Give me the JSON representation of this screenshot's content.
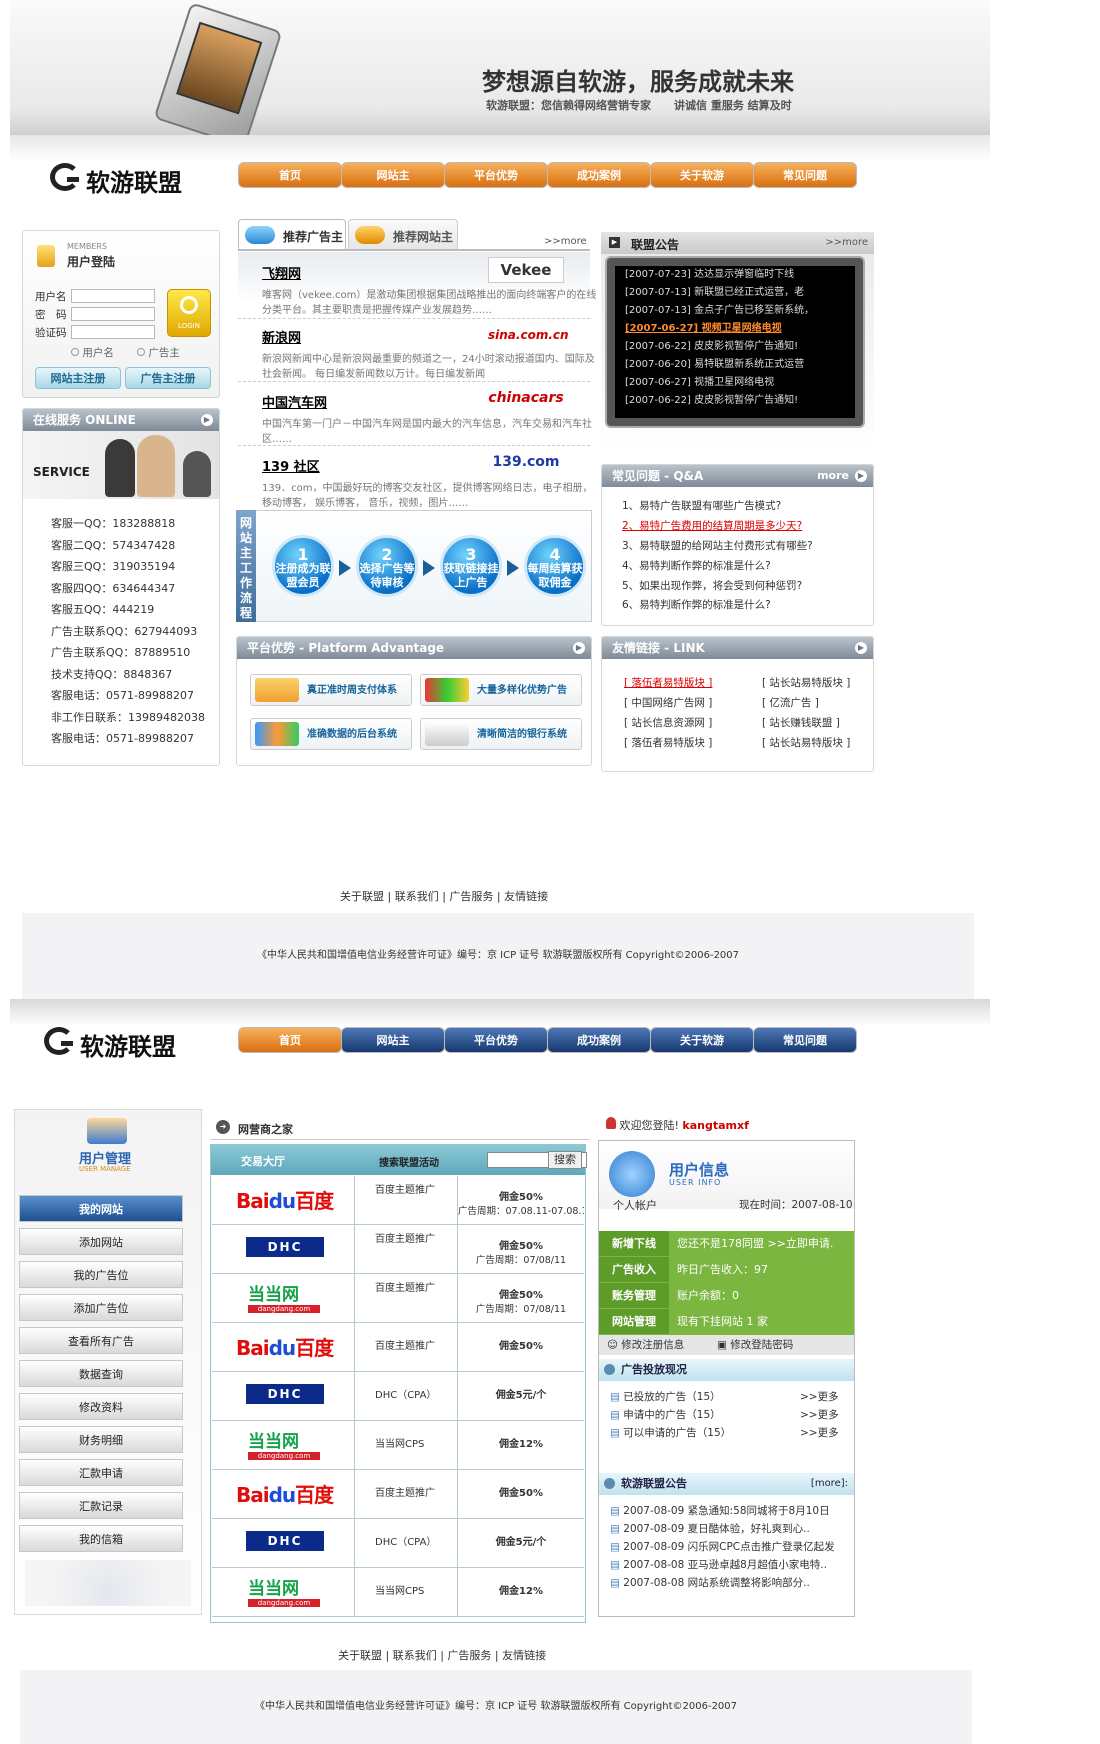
{
  "banner": {
    "slogan": "梦想源自软游，服务成就未来",
    "sub1": "软游联盟：您信赖得网络营销专家",
    "sub2": "讲诚信 重服务 结算及时"
  },
  "brand": {
    "name": "软游联盟"
  },
  "nav": [
    "首页",
    "网站主",
    "平台优势",
    "成功案例",
    "关于软游",
    "常见问题"
  ],
  "login": {
    "title": "用户登陆",
    "members": "MEMBERS",
    "user_label": "用户名",
    "pass_label": "密　码",
    "code_label": "验证码",
    "radio1": "用户名",
    "radio2": "广告主",
    "login_btn": "LOGIN",
    "reg_site": "网站主注册",
    "reg_adv": "广告主注册"
  },
  "online": {
    "title": "在线服务 ONLINE",
    "service": "SERVICE",
    "contacts": [
      "客服一QQ：183288818",
      "客服二QQ：574347428",
      "客服三QQ：319035194",
      "客服四QQ：634644347",
      "客服五QQ：444219",
      "广告主联系QQ：627944093",
      "广告主联系QQ：87889510",
      "技术支持QQ：8848367",
      "客服电话：0571-89988207",
      "非工作日联系：13989482038",
      "客服电话：0571-89988207"
    ]
  },
  "tabs": {
    "tab1": "推荐广告主",
    "tab2": "推荐网站主",
    "more": ">>more"
  },
  "ads_list": [
    {
      "name": "飞翔网",
      "logo": "Vekee",
      "desc": "唯客网（vekee.com）是激动集团根据集团战略推出的面向终端客户的在线分类平台。其主要职责是把握传媒产业发展趋势……"
    },
    {
      "name": "新浪网",
      "logo": "sina.com.cn",
      "desc": "新浪网新闻中心是新浪网最重要的频道之一，24小时滚动报道国内、国际及社会新闻。 每日编发新闻数以万计。每日编发新闻"
    },
    {
      "name": "中国汽车网",
      "logo": "chinacars",
      "desc": "中国汽车第一门户－中国汽车网是国内最大的汽车信息，汽车交易和汽车社区……"
    },
    {
      "name": "139 社区",
      "logo": "139.com",
      "desc": "139．com，中国最好玩的博客交友社区，提供博客网络日志，电子相册，移动博客， 娱乐博客， 音乐，视频，图片……"
    }
  ],
  "flow": {
    "title": "网站主工作流程",
    "steps": [
      {
        "n": "1",
        "t": "注册成为联盟会员"
      },
      {
        "n": "2",
        "t": "选择广告等待审核"
      },
      {
        "n": "3",
        "t": "获取链接挂上广告"
      },
      {
        "n": "4",
        "t": "每周结算获取佣金"
      }
    ]
  },
  "notice": {
    "title": "联盟公告",
    "more": ">>more",
    "items": [
      "[2007-07-23] 达达显示弹窗临时下线",
      "[2007-07-13] 新联盟已经正式运营，老",
      "[2007-07-13] 金点子广告已移至新系统，",
      "[2007-06-27] 视频卫星网络电视",
      "[2007-06-22] 皮皮影视暂停广告通知!",
      "[2007-06-20] 易特联盟新系统正式运营",
      "[2007-06-27] 视播卫星网络电视",
      "[2007-06-22] 皮皮影视暂停广告通知!"
    ]
  },
  "faq": {
    "title": "常见问题 - Q&A",
    "more": "more",
    "items": [
      "1、易特广告联盟有哪些广告模式?",
      "2、易特广告费用的结算周期是多少天?",
      "3、易特联盟的给网站主付费形式有哪些?",
      "4、易特判断作弊的标准是什么?",
      "5、如果出现作弊，将会受到何种惩罚?",
      "6、易特判断作弊的标准是什么?"
    ]
  },
  "platform": {
    "title": "平台优势 - Platform Advantage",
    "items": [
      "真正准时周支付体系",
      "大量多样化优势广告",
      "准确数据的后台系统",
      "清晰简洁的银行系统"
    ]
  },
  "links": {
    "title": "友情链接 - LINK",
    "items": [
      "[ 落伍者易特版块 ]",
      "[ 站长站易特版块 ]",
      "[ 中国网络广告网 ]",
      "[ 亿流广告 ]",
      "[ 站长信息资源网 ]",
      "[ 站长赚钱联盟 ]",
      "[ 落伍者易特版块 ]",
      "[ 站长站易特版块 ]"
    ]
  },
  "footer": {
    "links": [
      "关于联盟",
      "联系我们",
      "广告服务",
      "友情链接"
    ],
    "copy": "《中华人民共和国增值电信业务经营许可证》编号：京 ICP 证号  软游联盟版权所有 Copyright©2006-2007"
  },
  "manage": {
    "title": "用户管理",
    "sub": "USER MANAGE",
    "menu": [
      "我的网站",
      "添加网站",
      "我的广告位",
      "添加广告位",
      "查看所有广告",
      "数据查询",
      "修改资料",
      "财务明细",
      "汇款申请",
      "汇款记录",
      "我的信箱"
    ]
  },
  "market": {
    "title": "网营商之家",
    "hall": "交易大厅",
    "search_label": "搜索联盟活动",
    "search_btn": "搜索",
    "rows": [
      {
        "logo": "baidu",
        "type": "百度主题推广",
        "commission": "佣金50%",
        "period": "广告周期：07.08.11-07.08.19"
      },
      {
        "logo": "dhc",
        "type": "百度主题推广",
        "commission": "佣金50%",
        "period": "广告周期：07/08/11"
      },
      {
        "logo": "dangdang",
        "type": "百度主题推广",
        "commission": "佣金50%",
        "period": "广告周期：07/08/11"
      },
      {
        "logo": "baidu",
        "type": "百度主题推广",
        "commission": "佣金50%",
        "period": ""
      },
      {
        "logo": "dhc",
        "type": "DHC（CPA）",
        "commission": "佣金5元/个",
        "period": ""
      },
      {
        "logo": "dangdang",
        "type": "当当网CPS",
        "commission": "佣金12%",
        "period": ""
      },
      {
        "logo": "baidu",
        "type": "百度主题推广",
        "commission": "佣金50%",
        "period": ""
      },
      {
        "logo": "dhc",
        "type": "DHC（CPA）",
        "commission": "佣金5元/个",
        "period": ""
      },
      {
        "logo": "dangdang",
        "type": "当当网CPS",
        "commission": "佣金12%",
        "period": ""
      }
    ]
  },
  "userinfo": {
    "welcome": "欢迎您登陆!",
    "username": "kangtamxf",
    "title": "用户信息",
    "sub": "USER INFO",
    "account": "个人帐户",
    "time": "现在时间：2007-08-10",
    "rows": [
      {
        "label": "新增下线",
        "value": "您还不是178同盟 >>立即申请."
      },
      {
        "label": "广告收入",
        "value": "昨日广告收入：97"
      },
      {
        "label": "账务管理",
        "value": "账户余额：0"
      },
      {
        "label": "网站管理",
        "value": "现有下挂网站 1 家"
      }
    ],
    "edit_info": "修改注册信息",
    "edit_pwd": "修改登陆密码",
    "ad_status": "广告投放现况",
    "ad_items": [
      {
        "t": "已投放的广告（15）",
        "m": ">>更多"
      },
      {
        "t": "申请中的广告（15）",
        "m": ">>更多"
      },
      {
        "t": "可以申请的广告（15）",
        "m": ">>更多"
      }
    ],
    "notice_title": "软游联盟公告",
    "notice_more": "[more]:",
    "notices": [
      "2007-08-09 紧急通知:58同城将于8月10日",
      "2007-08-09 夏日酷体验，好礼爽到心..",
      "2007-08-09 闪乐网CPC点击推广登录亿起发",
      "2007-08-08 亚马逊卓越8月超值小家电特..",
      "2007-08-08 网站系统调整将影响部分.."
    ]
  },
  "colors": {
    "orange": "#e07a1c",
    "blue": "#1e4f92",
    "green": "#7ab640"
  }
}
